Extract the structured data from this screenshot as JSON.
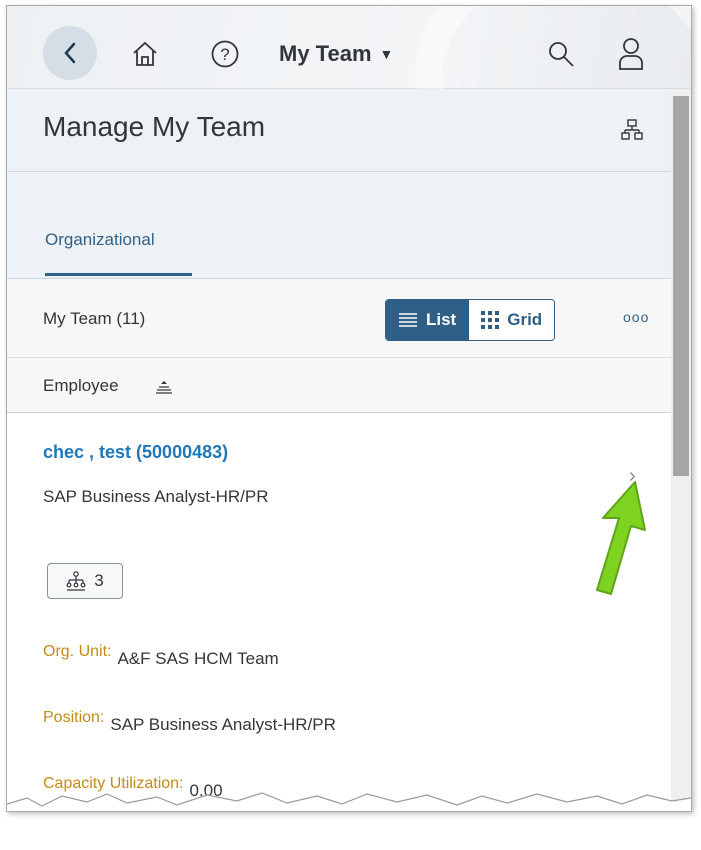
{
  "shell": {
    "title": "My Team",
    "caret": "▼"
  },
  "header": {
    "page_title": "Manage My Team"
  },
  "tabs": [
    {
      "label": "Organizational"
    }
  ],
  "toolbar": {
    "team_count": "My Team (11)",
    "list_label": "List",
    "grid_label": "Grid",
    "more": "ooo"
  },
  "column_header": {
    "label": "Employee"
  },
  "employee": {
    "name": "chec , test (50000483)",
    "position_subtitle": "SAP Business Analyst-HR/PR",
    "direct_reports": "3",
    "attributes": [
      {
        "key": "Org. Unit:",
        "value": "A&F SAS HCM Team"
      },
      {
        "key": "Position:",
        "value": "SAP Business Analyst-HR/PR"
      },
      {
        "key": "Capacity Utilization:",
        "value": "0.00"
      }
    ]
  },
  "colors": {
    "accent": "#2f5f86",
    "link": "#1f78b8",
    "attribute_key": "#c68a17",
    "annotation_arrow": "#7ed321"
  }
}
